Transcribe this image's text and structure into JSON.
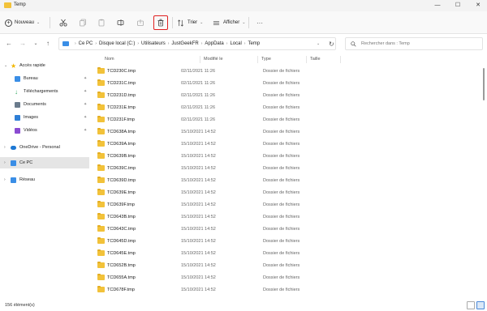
{
  "window": {
    "title": "Temp",
    "controls": [
      "—",
      "☐",
      "✕"
    ]
  },
  "toolbar": {
    "new_label": "Nouveau",
    "sort_label": "Trier",
    "view_label": "Afficher",
    "more_label": "···",
    "highlight_color": "#e02020"
  },
  "navigation": {
    "back": "←",
    "forward": "→",
    "recent": "⌄",
    "up": "↑",
    "breadcrumb": [
      "Ce PC",
      "Disque local (C:)",
      "Utilisateurs",
      "JustGeekFR",
      "AppData",
      "Local",
      "Temp"
    ],
    "search_placeholder": "Rechercher dans : Temp"
  },
  "sidebar": {
    "items": [
      {
        "label": "Accès rapide",
        "icon": "star-icon",
        "color": "#f2b600"
      },
      {
        "label": "Bureau",
        "icon": "desktop-icon",
        "color": "#3a8ee6"
      },
      {
        "label": "Téléchargements",
        "icon": "download-icon",
        "color": "#2aa35a"
      },
      {
        "label": "Documents",
        "icon": "document-icon",
        "color": "#6a7b8c"
      },
      {
        "label": "Images",
        "icon": "image-icon",
        "color": "#2f7fd6"
      },
      {
        "label": "Vidéos",
        "icon": "video-icon",
        "color": "#8a4bd1"
      },
      {
        "label": "OneDrive - Personal",
        "icon": "cloud-icon",
        "color": "#1d78d4"
      },
      {
        "label": "Ce PC",
        "icon": "computer-icon",
        "color": "#3a8ee6"
      },
      {
        "label": "Réseau",
        "icon": "network-icon",
        "color": "#3a8ee6"
      }
    ]
  },
  "table": {
    "columns": [
      "Nom",
      "Modifié le",
      "Type",
      "Taille"
    ],
    "rows": [
      {
        "name": "TCD230C.tmp",
        "date": "02/11/2021 11:26",
        "type": "Dossier de fichiers"
      },
      {
        "name": "TCD231C.tmp",
        "date": "02/11/2021 11:26",
        "type": "Dossier de fichiers"
      },
      {
        "name": "TCD231D.tmp",
        "date": "02/11/2021 11:26",
        "type": "Dossier de fichiers"
      },
      {
        "name": "TCD231E.tmp",
        "date": "02/11/2021 11:26",
        "type": "Dossier de fichiers"
      },
      {
        "name": "TCD231F.tmp",
        "date": "02/11/2021 11:26",
        "type": "Dossier de fichiers"
      },
      {
        "name": "TCD638A.tmp",
        "date": "15/10/2021 14:52",
        "type": "Dossier de fichiers"
      },
      {
        "name": "TCD639A.tmp",
        "date": "15/10/2021 14:52",
        "type": "Dossier de fichiers"
      },
      {
        "name": "TCD639B.tmp",
        "date": "15/10/2021 14:52",
        "type": "Dossier de fichiers"
      },
      {
        "name": "TCD639C.tmp",
        "date": "15/10/2021 14:52",
        "type": "Dossier de fichiers"
      },
      {
        "name": "TCD639D.tmp",
        "date": "15/10/2021 14:52",
        "type": "Dossier de fichiers"
      },
      {
        "name": "TCD639E.tmp",
        "date": "15/10/2021 14:52",
        "type": "Dossier de fichiers"
      },
      {
        "name": "TCD639F.tmp",
        "date": "15/10/2021 14:52",
        "type": "Dossier de fichiers"
      },
      {
        "name": "TCD643B.tmp",
        "date": "15/10/2021 14:52",
        "type": "Dossier de fichiers"
      },
      {
        "name": "TCD643C.tmp",
        "date": "15/10/2021 14:52",
        "type": "Dossier de fichiers"
      },
      {
        "name": "TCD645D.tmp",
        "date": "15/10/2021 14:52",
        "type": "Dossier de fichiers"
      },
      {
        "name": "TCD645E.tmp",
        "date": "15/10/2021 14:52",
        "type": "Dossier de fichiers"
      },
      {
        "name": "TCD652B.tmp",
        "date": "15/10/2021 14:52",
        "type": "Dossier de fichiers"
      },
      {
        "name": "TCD655A.tmp",
        "date": "15/10/2021 14:52",
        "type": "Dossier de fichiers"
      },
      {
        "name": "TCD678F.tmp",
        "date": "15/10/2021 14:52",
        "type": "Dossier de fichiers"
      }
    ]
  },
  "status": {
    "count": "156 élément(s)"
  }
}
